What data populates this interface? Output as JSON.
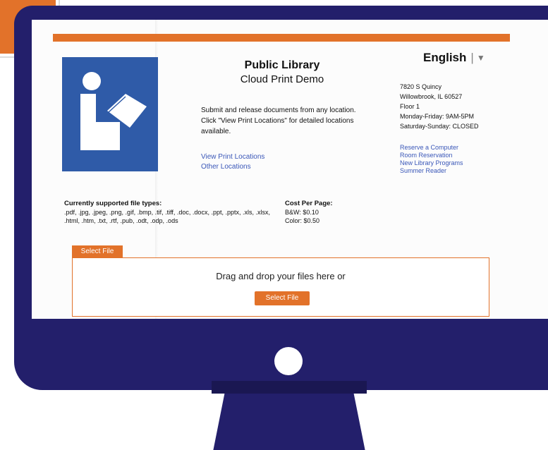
{
  "header": {
    "title": "Public Library",
    "subtitle": "Cloud Print Demo",
    "language": "English",
    "language_separator": "|",
    "language_caret": "▼"
  },
  "description": {
    "line1": "Submit and release documents from any location.",
    "line2": "Click \"View Print Locations\" for detailed locations available."
  },
  "links_left": [
    "View Print Locations",
    "Other Locations"
  ],
  "address": {
    "street": "7820 S Quincy",
    "city": "Willowbrook, IL 60527",
    "floor": "Floor 1",
    "weekday_hours": "Monday-Friday: 9AM-5PM",
    "weekend_hours": "Saturday-Sunday: CLOSED"
  },
  "links_right": [
    "Reserve a Computer",
    "Room Reservation",
    "New Library Programs",
    "Summer Reader"
  ],
  "file_types": {
    "heading": "Currently supported file types:",
    "list": ".pdf, .jpg, .jpeg, .png, .gif, .bmp, .tif, .tiff, .doc, .docx, .ppt, .pptx, .xls, .xlsx, .html, .htm, .txt, .rtf, .pub, .odt, .odp, .ods"
  },
  "cost": {
    "heading": "Cost Per Page:",
    "bw": "B&W:  $0.10",
    "color": "Color:  $0.50"
  },
  "upload": {
    "tab_label": "Select File",
    "drop_text": "Drag and drop your files here or",
    "button_label": "Select File"
  },
  "colors": {
    "accent": "#e2722a",
    "logo_blue": "#2f5ba8",
    "monitor": "#231f6b",
    "link": "#3a57b8"
  },
  "icons": {
    "logo": "reader-with-book-icon",
    "power": "power-button-icon"
  }
}
